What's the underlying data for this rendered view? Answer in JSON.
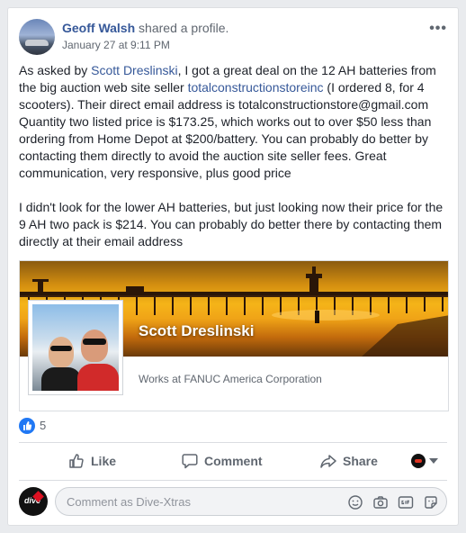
{
  "post": {
    "author": "Geoff Walsh",
    "action": " shared a profile.",
    "date": "January 27 at 9:11 PM",
    "menu": "•••",
    "text": {
      "p1_a": "As asked by ",
      "p1_link1": "Scott Dreslinski",
      "p1_b": ", I got a great deal on the 12 AH batteries from the big auction web site seller ",
      "p1_link2": "totalconstructionstoreinc",
      "p1_c": " (I ordered 8, for 4 scooters). Their direct email address is totalconstructionstore@gmail.com Quantity two listed price is $173.25, which works out to over $50 less than ordering from Home Depot at $200/battery.  You can probably do better by contacting them directly to avoid the auction site seller fees. Great communication, very responsive, plus good price",
      "p2": "I didn't look for the lower AH batteries, but just looking now their price for the 9 AH two pack is $214. You can probably do better there by contacting them directly at their email address"
    }
  },
  "shared_profile": {
    "name": "Scott Dreslinski",
    "subtitle": "Works at FANUC America Corporation"
  },
  "reactions": {
    "count": "5"
  },
  "actions": {
    "like": "Like",
    "comment": "Comment",
    "share": "Share"
  },
  "comment_box": {
    "placeholder": "Comment as Dive-Xtras",
    "avatar_text": "dive"
  },
  "colors": {
    "link": "#365899",
    "like_blue": "#2078f4",
    "muted": "#606770"
  }
}
